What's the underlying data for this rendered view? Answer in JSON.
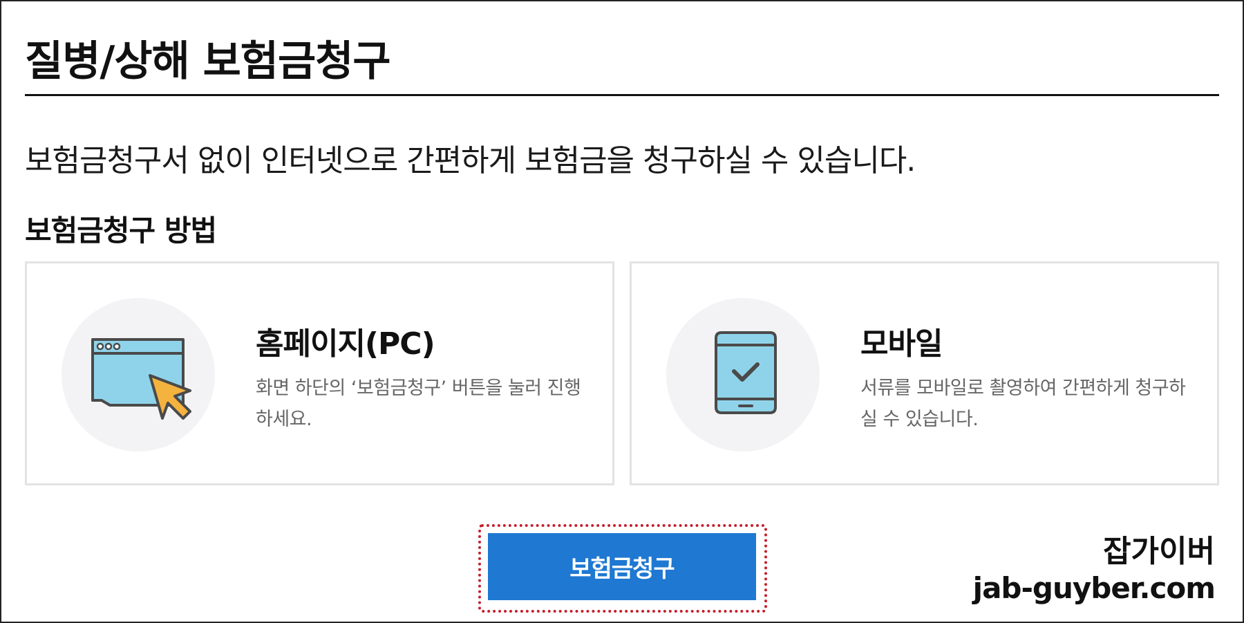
{
  "header": {
    "title": "질병/상해 보험금청구"
  },
  "intro": {
    "text": "보험금청구서 없이 인터넷으로 간편하게 보험금을 청구하실 수 있습니다."
  },
  "methods": {
    "section_title": "보험금청구 방법",
    "cards": [
      {
        "icon": "browser-window-cursor-icon",
        "title": "홈페이지(PC)",
        "description": "화면 하단의 ‘보험금청구’ 버튼을 눌러 진행하세요."
      },
      {
        "icon": "mobile-phone-check-icon",
        "title": "모바일",
        "description": "서류를 모바일로 촬영하여 간편하게 청구하실 수 있습니다."
      }
    ]
  },
  "actions": {
    "claim_button_label": "보험금청구"
  },
  "watermark": {
    "name": "잡가이버",
    "url": "jab-guyber.com"
  },
  "colors": {
    "accent": "#1f78d1",
    "highlight": "#c41f2c",
    "icon_fill": "#8fd3ea",
    "icon_cursor": "#f4b23f",
    "card_border": "#e3e3e3",
    "icon_bg": "#f3f3f5"
  }
}
